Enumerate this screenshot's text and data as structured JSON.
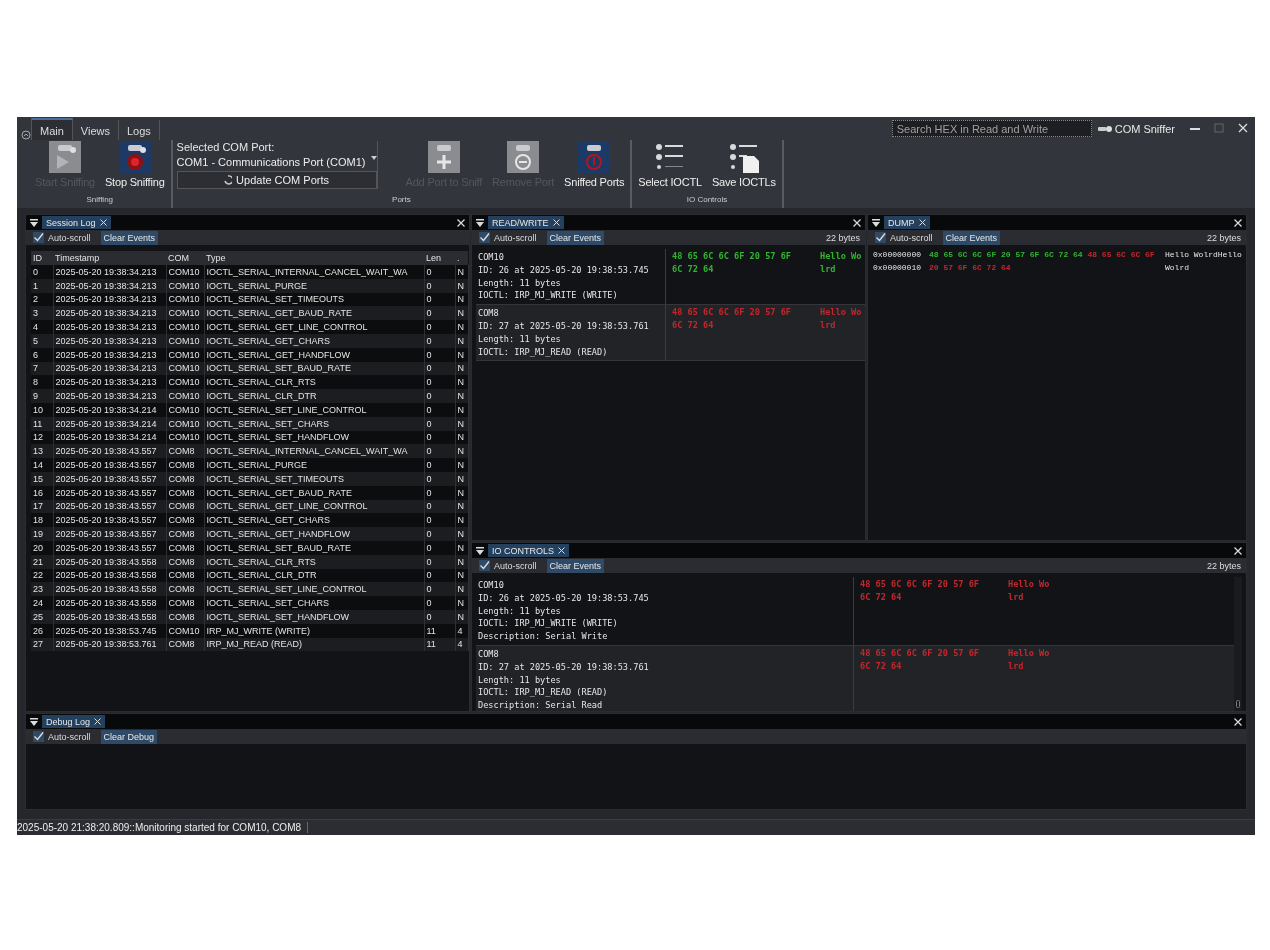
{
  "window": {
    "title": "COM Sniffer",
    "search_placeholder": "Search HEX in Read and Write"
  },
  "tabs": [
    {
      "label": "Main",
      "selected": true
    },
    {
      "label": "Views",
      "selected": false
    },
    {
      "label": "Logs",
      "selected": false
    }
  ],
  "ribbon_groups": [
    {
      "label": "Sniffing",
      "items": [
        {
          "kind": "button",
          "label": "Start Sniffing",
          "disabled": true
        },
        {
          "kind": "button",
          "label": "Stop Sniffing",
          "disabled": false
        }
      ]
    },
    {
      "label": "Ports",
      "items": [
        {
          "kind": "port-select",
          "label": "Selected COM Port:",
          "value": "COM1 - Communications Port (COM1)",
          "button": "Update COM Ports"
        },
        {
          "kind": "button",
          "label": "Add Port to Sniff",
          "disabled": true
        },
        {
          "kind": "button",
          "label": "Remove Port",
          "disabled": true
        },
        {
          "kind": "button",
          "label": "Sniffed Ports",
          "disabled": false
        }
      ]
    },
    {
      "label": "IO Controls",
      "items": [
        {
          "kind": "button",
          "label": "Select IOCTL",
          "disabled": false
        },
        {
          "kind": "button",
          "label": "Save IOCTLs",
          "disabled": false
        }
      ]
    }
  ],
  "session_log": {
    "title": "Session Log",
    "auto_scroll": true,
    "auto_scroll_label": "Auto-scroll",
    "clear_label": "Clear Events",
    "columns": [
      "ID",
      "Timestamp",
      "COM",
      "Type",
      "Len",
      "."
    ],
    "rows": [
      [
        "0",
        "2025-05-20 19:38:34.213",
        "COM10",
        "IOCTL_SERIAL_INTERNAL_CANCEL_WAIT_WA",
        "0",
        "N"
      ],
      [
        "1",
        "2025-05-20 19:38:34.213",
        "COM10",
        "IOCTL_SERIAL_PURGE",
        "0",
        "N"
      ],
      [
        "2",
        "2025-05-20 19:38:34.213",
        "COM10",
        "IOCTL_SERIAL_SET_TIMEOUTS",
        "0",
        "N"
      ],
      [
        "3",
        "2025-05-20 19:38:34.213",
        "COM10",
        "IOCTL_SERIAL_GET_BAUD_RATE",
        "0",
        "N"
      ],
      [
        "4",
        "2025-05-20 19:38:34.213",
        "COM10",
        "IOCTL_SERIAL_GET_LINE_CONTROL",
        "0",
        "N"
      ],
      [
        "5",
        "2025-05-20 19:38:34.213",
        "COM10",
        "IOCTL_SERIAL_GET_CHARS",
        "0",
        "N"
      ],
      [
        "6",
        "2025-05-20 19:38:34.213",
        "COM10",
        "IOCTL_SERIAL_GET_HANDFLOW",
        "0",
        "N"
      ],
      [
        "7",
        "2025-05-20 19:38:34.213",
        "COM10",
        "IOCTL_SERIAL_SET_BAUD_RATE",
        "0",
        "N"
      ],
      [
        "8",
        "2025-05-20 19:38:34.213",
        "COM10",
        "IOCTL_SERIAL_CLR_RTS",
        "0",
        "N"
      ],
      [
        "9",
        "2025-05-20 19:38:34.213",
        "COM10",
        "IOCTL_SERIAL_CLR_DTR",
        "0",
        "N"
      ],
      [
        "10",
        "2025-05-20 19:38:34.214",
        "COM10",
        "IOCTL_SERIAL_SET_LINE_CONTROL",
        "0",
        "N"
      ],
      [
        "11",
        "2025-05-20 19:38:34.214",
        "COM10",
        "IOCTL_SERIAL_SET_CHARS",
        "0",
        "N"
      ],
      [
        "12",
        "2025-05-20 19:38:34.214",
        "COM10",
        "IOCTL_SERIAL_SET_HANDFLOW",
        "0",
        "N"
      ],
      [
        "13",
        "2025-05-20 19:38:43.557",
        "COM8",
        "IOCTL_SERIAL_INTERNAL_CANCEL_WAIT_WA",
        "0",
        "N"
      ],
      [
        "14",
        "2025-05-20 19:38:43.557",
        "COM8",
        "IOCTL_SERIAL_PURGE",
        "0",
        "N"
      ],
      [
        "15",
        "2025-05-20 19:38:43.557",
        "COM8",
        "IOCTL_SERIAL_SET_TIMEOUTS",
        "0",
        "N"
      ],
      [
        "16",
        "2025-05-20 19:38:43.557",
        "COM8",
        "IOCTL_SERIAL_GET_BAUD_RATE",
        "0",
        "N"
      ],
      [
        "17",
        "2025-05-20 19:38:43.557",
        "COM8",
        "IOCTL_SERIAL_GET_LINE_CONTROL",
        "0",
        "N"
      ],
      [
        "18",
        "2025-05-20 19:38:43.557",
        "COM8",
        "IOCTL_SERIAL_GET_CHARS",
        "0",
        "N"
      ],
      [
        "19",
        "2025-05-20 19:38:43.557",
        "COM8",
        "IOCTL_SERIAL_GET_HANDFLOW",
        "0",
        "N"
      ],
      [
        "20",
        "2025-05-20 19:38:43.557",
        "COM8",
        "IOCTL_SERIAL_SET_BAUD_RATE",
        "0",
        "N"
      ],
      [
        "21",
        "2025-05-20 19:38:43.558",
        "COM8",
        "IOCTL_SERIAL_CLR_RTS",
        "0",
        "N"
      ],
      [
        "22",
        "2025-05-20 19:38:43.558",
        "COM8",
        "IOCTL_SERIAL_CLR_DTR",
        "0",
        "N"
      ],
      [
        "23",
        "2025-05-20 19:38:43.558",
        "COM8",
        "IOCTL_SERIAL_SET_LINE_CONTROL",
        "0",
        "N"
      ],
      [
        "24",
        "2025-05-20 19:38:43.558",
        "COM8",
        "IOCTL_SERIAL_SET_CHARS",
        "0",
        "N"
      ],
      [
        "25",
        "2025-05-20 19:38:43.558",
        "COM8",
        "IOCTL_SERIAL_SET_HANDFLOW",
        "0",
        "N"
      ],
      [
        "26",
        "2025-05-20 19:38:53.745",
        "COM10",
        "IRP_MJ_WRITE (WRITE)",
        "11",
        "4"
      ],
      [
        "27",
        "2025-05-20 19:38:53.761",
        "COM8",
        "IRP_MJ_READ (READ)",
        "11",
        "4"
      ]
    ]
  },
  "read_write": {
    "title": "READ/WRITE",
    "auto_scroll": true,
    "auto_scroll_label": "Auto-scroll",
    "clear_label": "Clear Events",
    "byte_count": "22 bytes",
    "entries": [
      {
        "lines": [
          "COM10",
          "ID: 26 at 2025-05-20 19:38:53.745",
          "Length: 11 bytes",
          "IOCTL: IRP_MJ_WRITE (WRITE)"
        ],
        "hex": [
          "48 65 6C 6C 6F 20 57 6F",
          "6C 72 64"
        ],
        "ascii": [
          "Hello Wo",
          "lrd"
        ],
        "color": "#2fb52f"
      },
      {
        "lines": [
          "COM8",
          "ID: 27 at 2025-05-20 19:38:53.761",
          "Length: 11 bytes",
          "IOCTL: IRP_MJ_READ (READ)"
        ],
        "hex": [
          "48 65 6C 6C 6F 20 57 6F",
          "6C 72 64"
        ],
        "ascii": [
          "Hello Wo",
          "lrd"
        ],
        "color": "#c4262c"
      }
    ]
  },
  "dump": {
    "title": "DUMP",
    "auto_scroll": true,
    "auto_scroll_label": "Auto-scroll",
    "clear_label": "Clear Events",
    "byte_count": "22 bytes",
    "rows": [
      {
        "address": "0x00000000",
        "segments": [
          {
            "text": "48 65 6C 6C 6F 20 57 6F 6C 72 64",
            "color": "#2fb52f"
          },
          {
            "text": "48 65 6C 6C 6F",
            "color": "#c4262c"
          }
        ],
        "ascii": "Hello WolrdHello"
      },
      {
        "address": "0x00000010",
        "segments": [
          {
            "text": "20 57 6F 6C 72 64",
            "color": "#c4262c"
          }
        ],
        "ascii": "Wolrd"
      }
    ]
  },
  "io_controls": {
    "title": "IO CONTROLS",
    "auto_scroll": true,
    "auto_scroll_label": "Auto-scroll",
    "clear_label": "Clear Events",
    "byte_count": "22 bytes",
    "entries": [
      {
        "lines": [
          "COM10",
          "ID: 26 at 2025-05-20 19:38:53.745",
          "Length: 11 bytes",
          "IOCTL: IRP_MJ_WRITE (WRITE)",
          "Description: Serial Write"
        ],
        "hex": [
          "48 65 6C 6C 6F 20 57 6F",
          "6C 72 64"
        ],
        "ascii": [
          "Hello Wo",
          "lrd"
        ],
        "color": "#c4262c"
      },
      {
        "lines": [
          "COM8",
          "ID: 27 at 2025-05-20 19:38:53.761",
          "Length: 11 bytes",
          "IOCTL: IRP_MJ_READ (READ)",
          "Description: Serial Read"
        ],
        "hex": [
          "48 65 6C 6C 6F 20 57 6F",
          "6C 72 64"
        ],
        "ascii": [
          "Hello Wo",
          "lrd"
        ],
        "color": "#c4262c"
      }
    ]
  },
  "debug_log": {
    "title": "Debug Log",
    "auto_scroll": true,
    "auto_scroll_label": "Auto-scroll",
    "clear_label": "Clear Debug"
  },
  "status_bar": {
    "text": "2025-05-20 21:38:20.809::Monitoring started for COM10, COM8"
  }
}
